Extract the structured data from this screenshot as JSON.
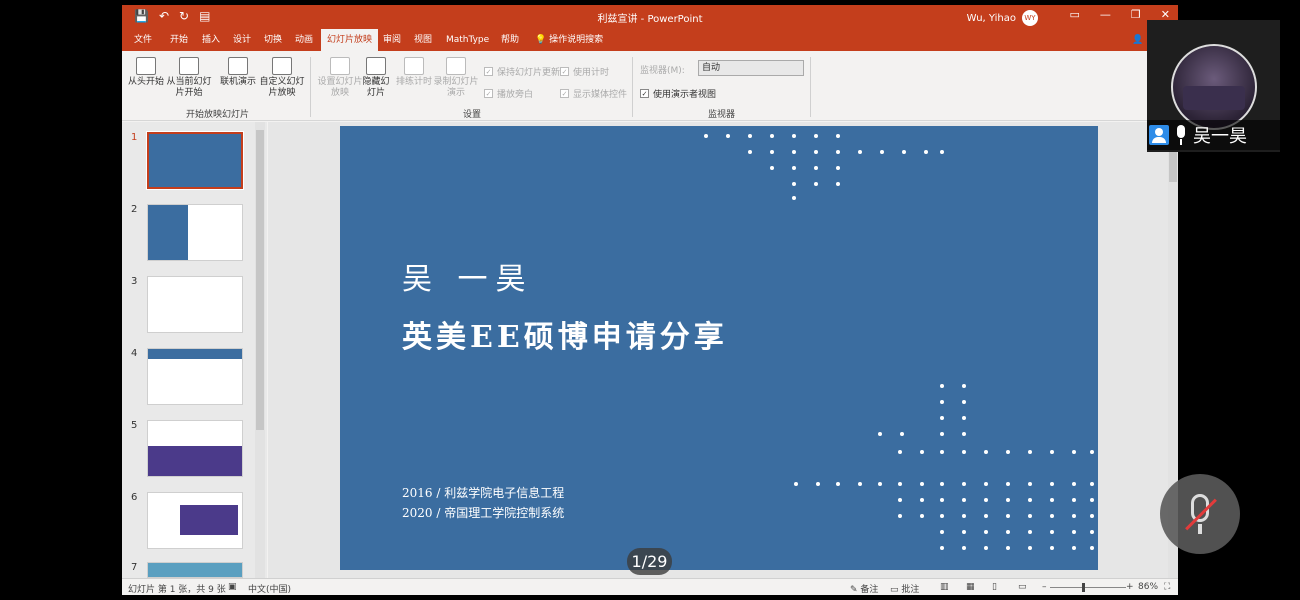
{
  "titlebar": {
    "title": "利兹宣讲 - PowerPoint",
    "user_name": "Wu, Yihao",
    "user_initials": "WY",
    "quick_access": [
      "💾",
      "↶",
      "↻",
      "▤"
    ],
    "controls": [
      "▭",
      "—",
      "❐",
      "✕"
    ]
  },
  "tabs": [
    "文件",
    "开始",
    "插入",
    "设计",
    "切换",
    "动画",
    "幻灯片放映",
    "审阅",
    "视图",
    "MathType",
    "帮助",
    "操作说明搜索"
  ],
  "active_tab": "幻灯片放映",
  "ribbon": {
    "start_group": {
      "label": "开始放映幻灯片",
      "buttons": [
        "从头开始",
        "从当前幻灯片开始",
        "联机演示",
        "自定义幻灯片放映"
      ]
    },
    "setup_group": {
      "label": "设置",
      "buttons": [
        "设置幻灯片放映",
        "隐藏幻灯片",
        "排练计时",
        "录制幻灯片演示"
      ],
      "checkboxes": [
        {
          "label": "保持幻灯片更新",
          "checked": true,
          "enabled": false
        },
        {
          "label": "播放旁白",
          "checked": true,
          "enabled": false
        },
        {
          "label": "使用计时",
          "checked": true,
          "enabled": false
        },
        {
          "label": "显示媒体控件",
          "checked": true,
          "enabled": false
        }
      ]
    },
    "monitor_group": {
      "label": "监视器",
      "monitor_label": "监视器(M):",
      "monitor_value": "自动",
      "presenter_view": "使用演示者视图"
    }
  },
  "thumbnails": [
    "1",
    "2",
    "3",
    "4",
    "5",
    "6",
    "7"
  ],
  "slide": {
    "name": "吴  一昊",
    "headline": "英美EE硕博申请分享",
    "line1": "2016 / 利兹学院电子信息工程",
    "line2": "2020 / 帝国理工学院控制系统",
    "bg_color": "#3b6da0"
  },
  "slide_counter": "1/29",
  "statusbar": {
    "slide_info": "幻灯片 第 1 张，共 9 张",
    "language": "中文(中国)",
    "notes": "备注",
    "comments": "批注",
    "zoom": "86%"
  },
  "video": {
    "participant_name": "吴一昊"
  }
}
